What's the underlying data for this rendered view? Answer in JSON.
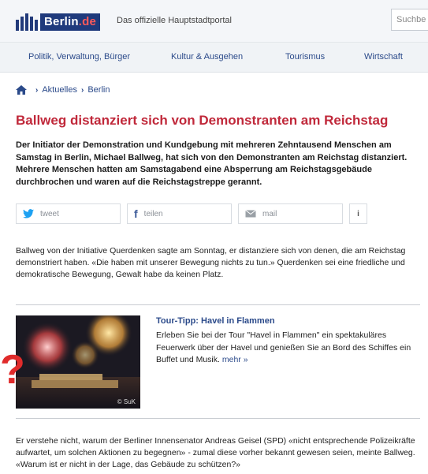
{
  "header": {
    "logo_text": "Berlin",
    "logo_suffix": ".de",
    "tagline": "Das offizielle Hauptstadtportal",
    "search_placeholder": "Suchbe"
  },
  "nav": {
    "items": [
      "Politik, Verwaltung, Bürger",
      "Kultur & Ausgehen",
      "Tourismus",
      "Wirtschaft"
    ]
  },
  "breadcrumb": {
    "items": [
      "Aktuelles",
      "Berlin"
    ]
  },
  "article": {
    "headline": "Ballweg distanziert sich von Demonstranten am Reichstag",
    "lead": "Der Initiator der Demonstration und Kundgebung mit mehreren Zehntausend Menschen am Samstag in Berlin, Michael Ballweg, hat sich von den Demonstranten am Reichstag distanziert. Mehrere Menschen hatten am Samstagabend eine Absperrung am Reichstagsgebäude durchbrochen und waren auf die Reichstagstreppe gerannt.",
    "paragraph1": "Ballweg von der Initiative Querdenken sagte am Sonntag, er distanziere sich von denen, die am Reichstag demonstriert haben. «Die haben mit unserer Bewegung nichts zu tun.» Querdenken sei eine friedliche und demokratische Bewegung, Gewalt habe da keinen Platz.",
    "paragraph2": "Er verstehe nicht, warum der Berliner Innensenator Andreas Geisel (SPD) «nicht entsprechende Polizeikräfte aufwartet, um solchen Aktionen zu begegnen» - zumal diese vorher bekannt gewesen seien, meinte Ballweg. «Warum ist er nicht in der Lage, das Gebäude zu schützen?»"
  },
  "share": {
    "tweet": "tweet",
    "teilen": "teilen",
    "mail": "mail",
    "info": "i"
  },
  "promo": {
    "title": "Tour-Tipp: Havel in Flammen",
    "text": "Erleben Sie bei der Tour \"Havel in Flammen\" ein spektakuläres Feuerwerk über der Havel und genießen Sie an Bord des Schiffes ein Buffet und Musik.",
    "more": "mehr »",
    "credit": "© SuK",
    "overlay_mark": "?"
  },
  "colors": {
    "brand_blue": "#1f3a7c",
    "headline_red": "#c0283a",
    "link_blue": "#2b4a8a"
  }
}
